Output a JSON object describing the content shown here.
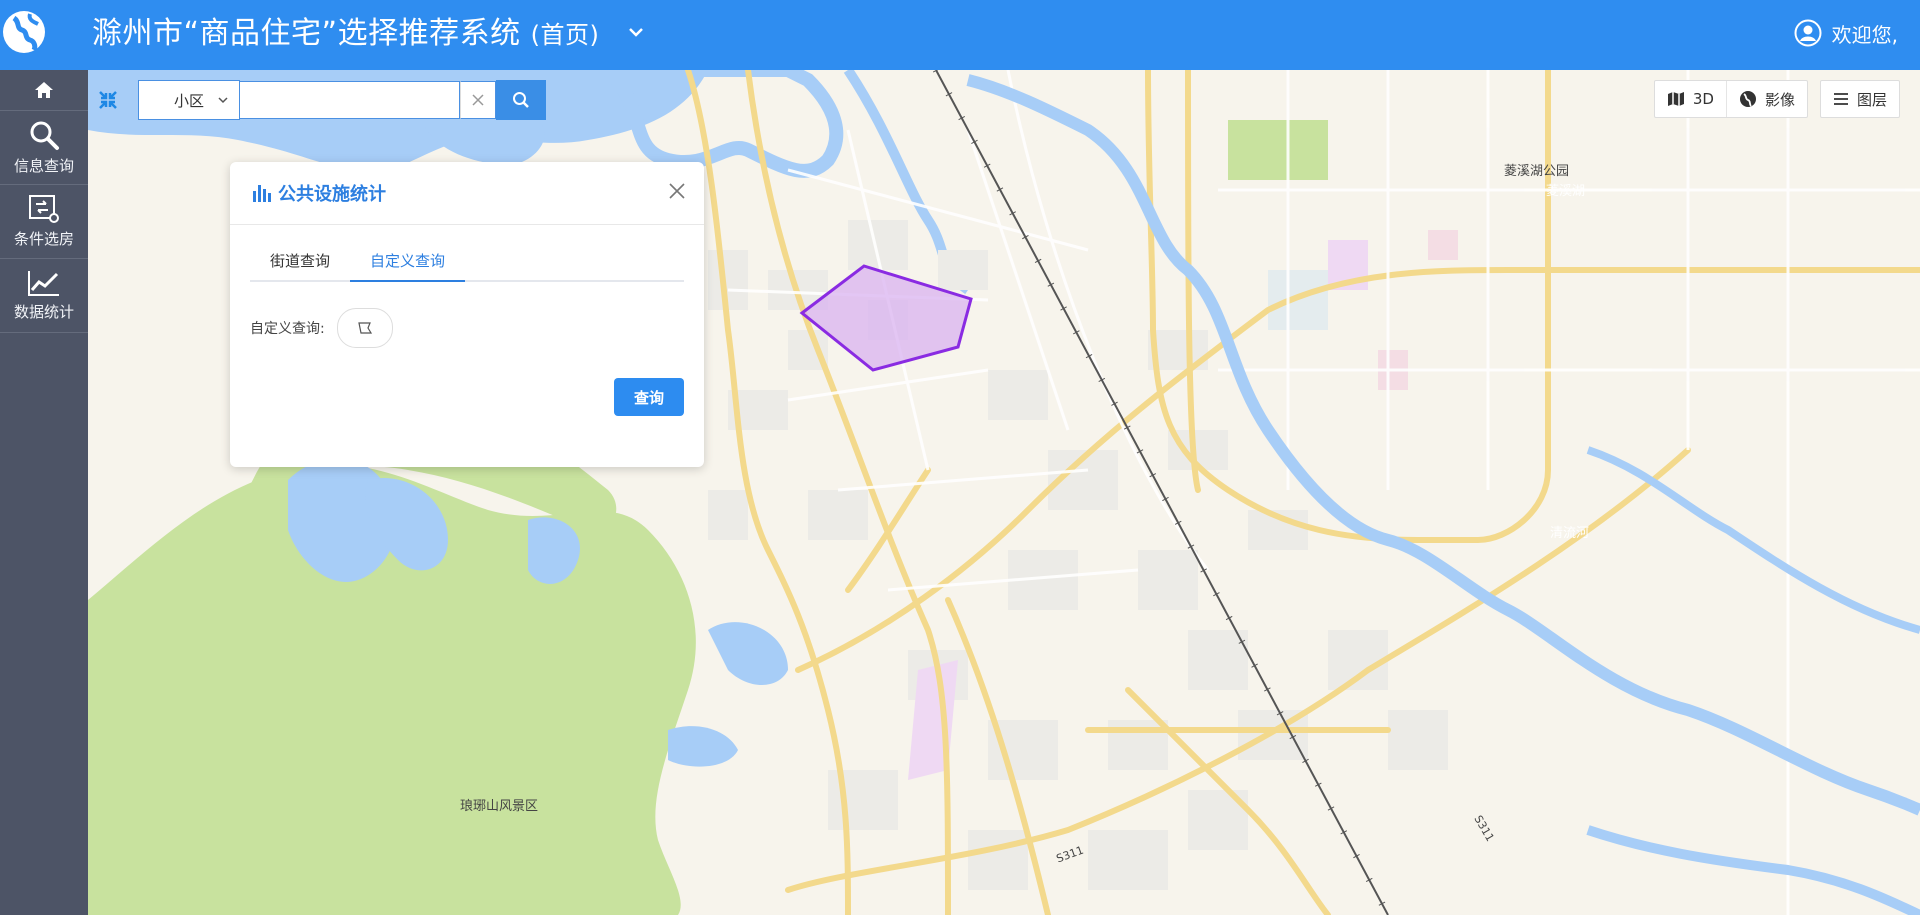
{
  "header": {
    "title": "滁州市“商品住宅”选择推荐系统",
    "subtitle": "(首页)",
    "welcome": "欢迎您,"
  },
  "sidebar": {
    "items": [
      {
        "label": "",
        "icon": "home-icon"
      },
      {
        "label": "信息查询",
        "icon": "search-icon"
      },
      {
        "label": "条件选房",
        "icon": "filter-settings-icon"
      },
      {
        "label": "数据统计",
        "icon": "line-chart-icon"
      }
    ]
  },
  "search": {
    "type_selected": "小区",
    "value": "",
    "placeholder": ""
  },
  "map_tools": {
    "btn_3d": "3D",
    "btn_imagery": "影像",
    "btn_layers": "图层"
  },
  "panel": {
    "title": "公共设施统计",
    "tabs": [
      "街道查询",
      "自定义查询"
    ],
    "active_tab": "自定义查询",
    "field_label": "自定义查询:",
    "query_button": "查询"
  },
  "map": {
    "labels": {
      "scenic": "琅琊山风景区",
      "park": "菱溪湖公园",
      "lake": "菱溪湖",
      "river": "清流河",
      "road1": "S311",
      "road2": "S311"
    },
    "colors": {
      "water": "#a7cdf7",
      "green": "#c8e29e",
      "road": "#f3d98c",
      "land": "#f7f4ec",
      "polygon": "#8a2be2"
    }
  }
}
